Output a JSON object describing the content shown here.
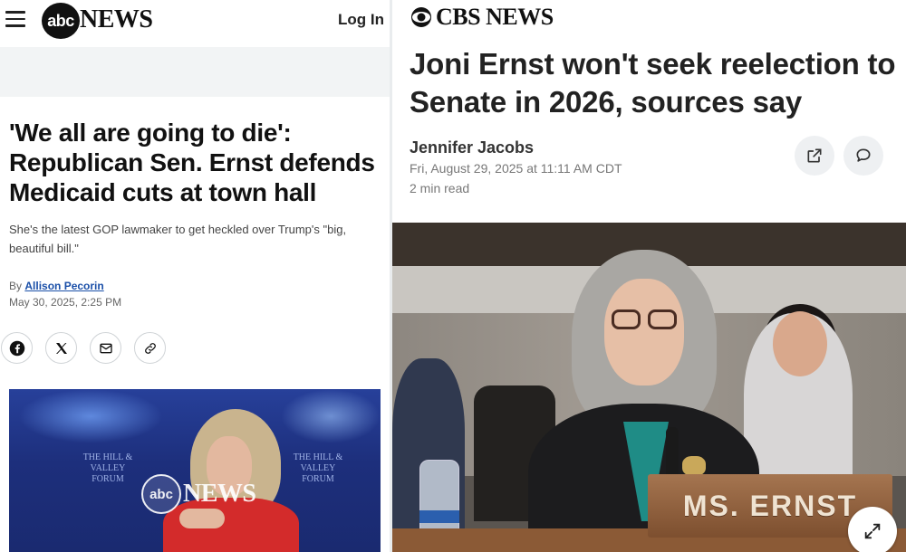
{
  "abc": {
    "logo_text": "abc",
    "brand_word": "NEWS",
    "login_label": "Log In",
    "headline": "'We all are going to die': Republican Sen. Ernst defends Medicaid cuts at town hall",
    "subheadline": "She's the latest GOP lawmaker to get heckled over Trump's \"big, beautiful bill.\"",
    "byline_prefix": "By",
    "author": "Allison Pecorin",
    "date": "May 30, 2025, 2:25 PM",
    "share_icons": [
      "facebook-icon",
      "x-icon",
      "email-icon",
      "link-icon"
    ],
    "photo": {
      "watermark_logo": "abc",
      "watermark_word": "NEWS",
      "backdrop_text": "THE HILL & VALLEY FORUM"
    }
  },
  "cbs": {
    "brand_word": "CBS NEWS",
    "headline": "Joni Ernst won't seek reelection to Senate in 2026, sources say",
    "author": "Jennifer Jacobs",
    "date": "Fri, August 29, 2025 at 11:11 AM CDT",
    "read_time": "2 min read",
    "action_icons": [
      "share-external-icon",
      "comment-icon"
    ],
    "photo": {
      "nameplate": "MS. ERNST",
      "expand_icon": "expand-icon"
    }
  },
  "colors": {
    "abc_link": "#1a4fa8",
    "abc_photo_bg": "#1d2f7c",
    "jacket_red": "#d32b2b",
    "cbs_icon_btn_bg": "#eef0f2",
    "nameplate_wood": "#8b5a36"
  }
}
